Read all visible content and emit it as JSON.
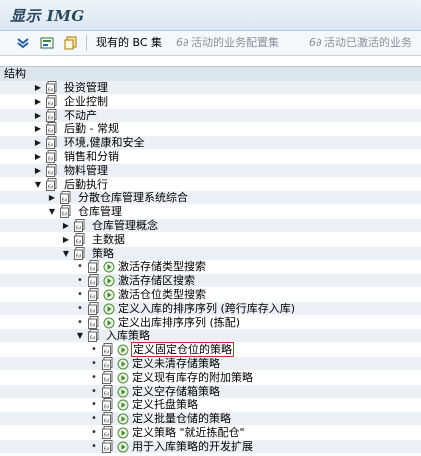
{
  "window": {
    "title": "显示 IMG"
  },
  "toolbar": {
    "existing_bc_sets": "现有的 BC 集",
    "bc_active_config": "活动的业务配置集",
    "bc_inactive_config": "活动已激活的业务"
  },
  "tree_header": {
    "label": "结构"
  },
  "tree": {
    "items": [
      {
        "label": "投资管理"
      },
      {
        "label": "企业控制"
      },
      {
        "label": "不动产"
      },
      {
        "label": "后勤 - 常规"
      },
      {
        "label": "环境,健康和安全"
      },
      {
        "label": "销售和分销"
      },
      {
        "label": "物料管理"
      },
      {
        "label": "后勤执行"
      },
      {
        "label": "分散仓库管理系统综合"
      },
      {
        "label": "仓库管理"
      },
      {
        "label": "仓库管理概念"
      },
      {
        "label": "主数据"
      },
      {
        "label": "策略"
      },
      {
        "label": "激活存储类型搜索"
      },
      {
        "label": "激活存储区搜索"
      },
      {
        "label": "激活仓位类型搜索"
      },
      {
        "label": "定义入库的排序序列 (跨行库存入库)"
      },
      {
        "label": "定义出库排序序列 (拣配)"
      },
      {
        "label": "入库策略"
      },
      {
        "label": "定义固定仓位的策略"
      },
      {
        "label": "定义未清存储策略"
      },
      {
        "label": "定义现有库存的附加策略"
      },
      {
        "label": "定义空存储箱策略"
      },
      {
        "label": "定义托盘策略"
      },
      {
        "label": "定义批量仓储的策略"
      },
      {
        "label": "定义策略 \"就近拣配仓\""
      },
      {
        "label": "用于入库策略的开发扩展"
      }
    ]
  }
}
